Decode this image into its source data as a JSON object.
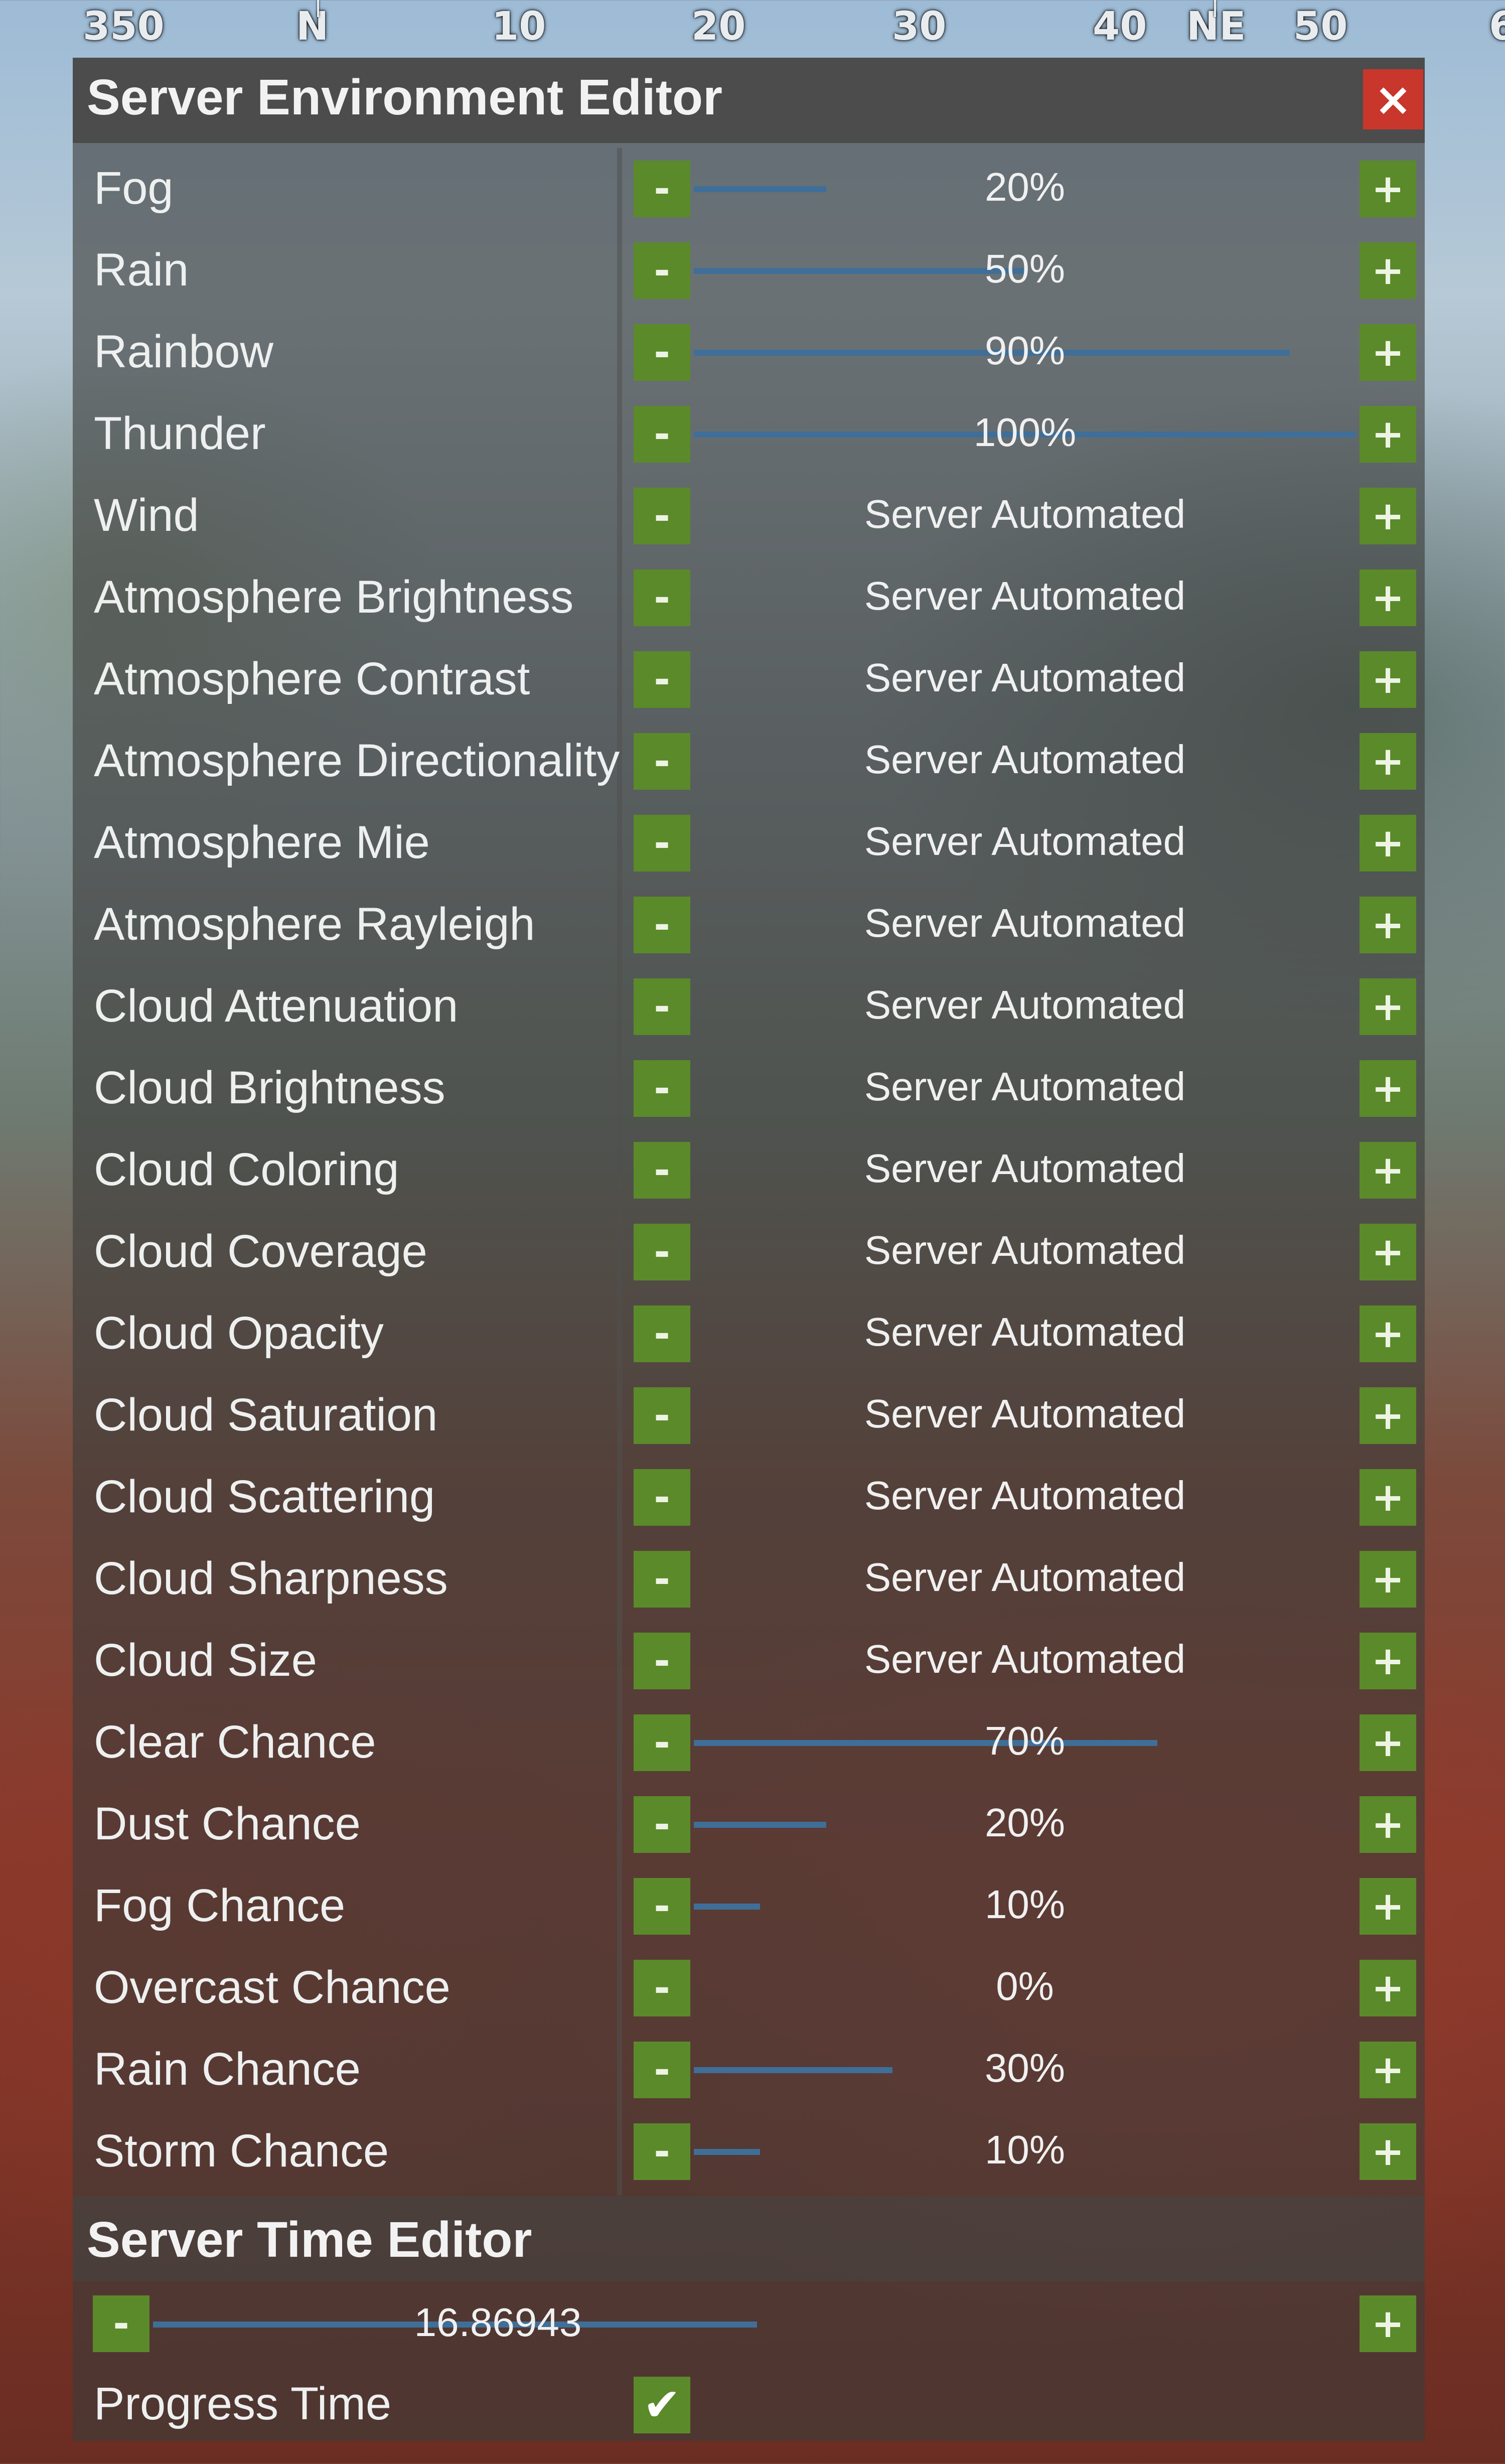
{
  "compass": {
    "labels": [
      "350",
      "N",
      "10",
      "20",
      "30",
      "40",
      "NE",
      "50",
      "6"
    ]
  },
  "panel": {
    "title": "Server Environment Editor",
    "close_label": "×",
    "minus_label": "-",
    "plus_label": "+",
    "rows": [
      {
        "name": "Fog",
        "value": "20%",
        "fraction": 0.2
      },
      {
        "name": "Rain",
        "value": "50%",
        "fraction": 0.5
      },
      {
        "name": "Rainbow",
        "value": "90%",
        "fraction": 0.9
      },
      {
        "name": "Thunder",
        "value": "100%",
        "fraction": 1.0
      },
      {
        "name": "Wind",
        "value": "Server Automated"
      },
      {
        "name": "Atmosphere Brightness",
        "value": "Server Automated"
      },
      {
        "name": "Atmosphere Contrast",
        "value": "Server Automated"
      },
      {
        "name": "Atmosphere Directionality",
        "value": "Server Automated"
      },
      {
        "name": "Atmosphere Mie",
        "value": "Server Automated"
      },
      {
        "name": "Atmosphere Rayleigh",
        "value": "Server Automated"
      },
      {
        "name": "Cloud Attenuation",
        "value": "Server Automated"
      },
      {
        "name": "Cloud Brightness",
        "value": "Server Automated"
      },
      {
        "name": "Cloud Coloring",
        "value": "Server Automated"
      },
      {
        "name": "Cloud Coverage",
        "value": "Server Automated"
      },
      {
        "name": "Cloud Opacity",
        "value": "Server Automated"
      },
      {
        "name": "Cloud Saturation",
        "value": "Server Automated"
      },
      {
        "name": "Cloud Scattering",
        "value": "Server Automated"
      },
      {
        "name": "Cloud Sharpness",
        "value": "Server Automated"
      },
      {
        "name": "Cloud Size",
        "value": "Server Automated"
      },
      {
        "name": "Clear Chance",
        "value": "70%",
        "fraction": 0.7
      },
      {
        "name": "Dust Chance",
        "value": "20%",
        "fraction": 0.2
      },
      {
        "name": "Fog Chance",
        "value": "10%",
        "fraction": 0.1
      },
      {
        "name": "Overcast Chance",
        "value": "0%",
        "fraction": 0.0
      },
      {
        "name": "Rain Chance",
        "value": "30%",
        "fraction": 0.3
      },
      {
        "name": "Storm Chance",
        "value": "10%",
        "fraction": 0.1
      }
    ]
  },
  "time_editor": {
    "title": "Server Time Editor",
    "value": "16.86943",
    "fraction": 0.7,
    "minus_label": "-",
    "plus_label": "+"
  },
  "progress_time": {
    "label": "Progress Time",
    "checked": true,
    "check_glyph": "✔"
  },
  "colors": {
    "button_green": "#5b8a2a",
    "close_red": "#c9362b",
    "bar_blue": "#3f6f98"
  }
}
